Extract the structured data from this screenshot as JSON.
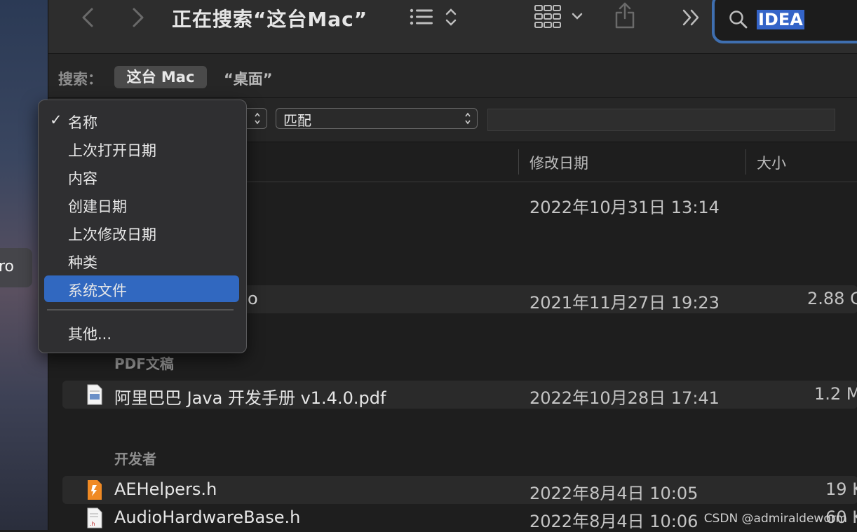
{
  "desktop": {
    "sidebar_fragment": "ro"
  },
  "toolbar": {
    "title": "正在搜索“这台Mac”",
    "search_value": "IDEA"
  },
  "scope": {
    "label": "搜索：",
    "this_mac": "这台 Mac",
    "desktop": "“桌面”"
  },
  "criteria": {
    "match_label": "匹配",
    "value": ""
  },
  "columns": {
    "modified": "修改日期",
    "size": "大小"
  },
  "rows": [
    {
      "name": "",
      "date": "2022年10月31日 13:14",
      "size": ""
    },
    {
      "name": "o",
      "date": "2021年11月27日 19:23",
      "size": "2.88 G"
    }
  ],
  "groups": [
    {
      "title": "PDF文稿",
      "items": [
        {
          "name": "阿里巴巴 Java 开发手册 v1.4.0.pdf",
          "date": "2022年10月28日 17:41",
          "size": "1.2 M",
          "icon": "pdf-file-icon"
        }
      ]
    },
    {
      "title": "开发者",
      "items": [
        {
          "name": "AEHelpers.h",
          "date": "2022年8月4日 10:05",
          "size": "19 K",
          "icon": "header-file-icon"
        },
        {
          "name": "AudioHardwareBase.h",
          "date": "2022年8月4日 10:06",
          "size": "60 K",
          "icon": "header-file-icon"
        }
      ]
    }
  ],
  "menu": {
    "items": [
      {
        "label": "名称",
        "checked": true,
        "selected": false
      },
      {
        "label": "上次打开日期",
        "checked": false,
        "selected": false
      },
      {
        "label": "内容",
        "checked": false,
        "selected": false
      },
      {
        "label": "创建日期",
        "checked": false,
        "selected": false
      },
      {
        "label": "上次修改日期",
        "checked": false,
        "selected": false
      },
      {
        "label": "种类",
        "checked": false,
        "selected": false
      },
      {
        "label": "系统文件",
        "checked": false,
        "selected": true
      }
    ],
    "other": "其他...",
    "checkmark": "✓"
  },
  "watermark": "CSDN @admiraldeworm",
  "colors": {
    "accent": "#3168c0",
    "search_ring": "#3f6fb0",
    "selection": "#3464c8"
  }
}
